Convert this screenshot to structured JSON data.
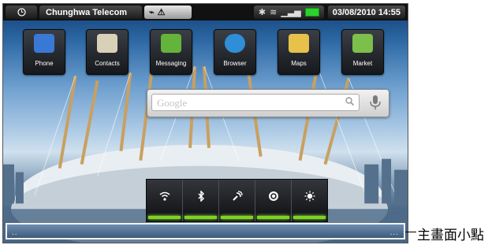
{
  "status_bar": {
    "carrier": "Chunghwa Telecom",
    "datetime": "03/08/2010 14:55"
  },
  "apps": [
    {
      "label": "Phone",
      "icon": "phone-icon",
      "color": "#3a78d6"
    },
    {
      "label": "Contacts",
      "icon": "contacts-icon",
      "color": "#d9d0b8"
    },
    {
      "label": "Messaging",
      "icon": "messaging-icon",
      "color": "#64b33a"
    },
    {
      "label": "Browser",
      "icon": "globe-icon",
      "color": "#2f8ed8"
    },
    {
      "label": "Maps",
      "icon": "maps-icon",
      "color": "#e6c24a"
    },
    {
      "label": "Market",
      "icon": "market-icon",
      "color": "#7cbf4a"
    }
  ],
  "search": {
    "placeholder": "Google"
  },
  "power_widget": [
    {
      "name": "wifi-toggle",
      "icon": "wifi-icon",
      "active": true
    },
    {
      "name": "bluetooth-toggle",
      "icon": "bluetooth-icon",
      "active": true
    },
    {
      "name": "gps-toggle",
      "icon": "gps-icon",
      "active": true
    },
    {
      "name": "sync-toggle",
      "icon": "sync-icon",
      "active": true
    },
    {
      "name": "brightness-toggle",
      "icon": "brightness-icon",
      "active": true
    }
  ],
  "home_dots": {
    "left": "..",
    "right": "..."
  },
  "callout": {
    "label": "主畫面小點"
  },
  "colors": {
    "indicator_on": "#7ed321",
    "battery": "#2cd22c"
  }
}
